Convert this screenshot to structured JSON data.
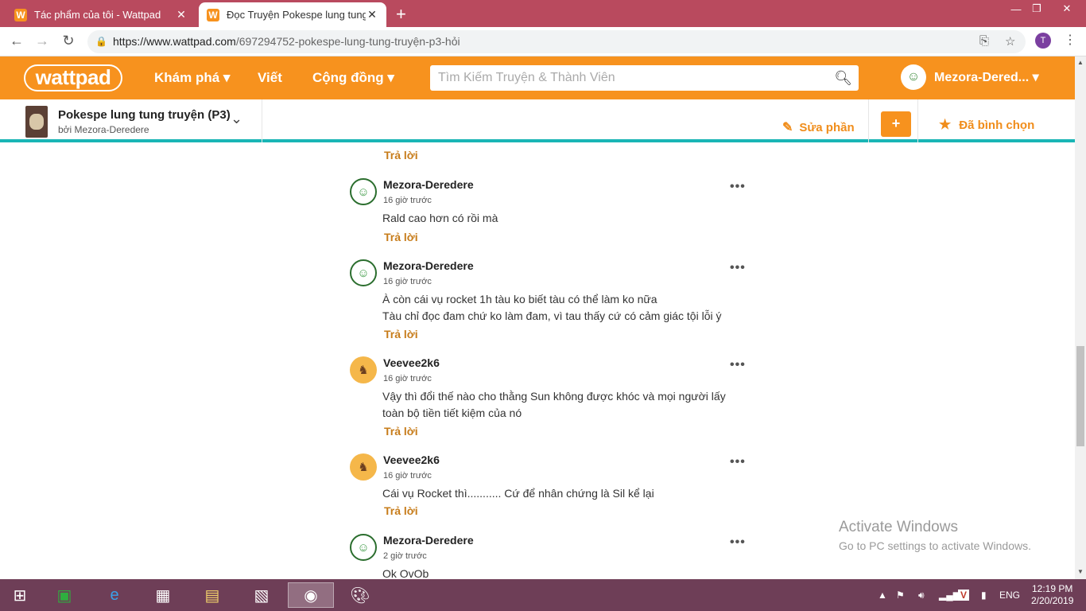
{
  "browser": {
    "tabs": [
      {
        "label": "Tác phẩm của tôi - Wattpad",
        "icon": "wattpad-icon"
      },
      {
        "label": "Đọc Truyện Pokespe lung tung tr",
        "icon": "wattpad-icon"
      }
    ],
    "url_host": "https://www.wattpad.com",
    "url_path": "/697294752-pokespe-lung-tung-truyện-p3-hỏi",
    "profile_initial": "T"
  },
  "wattpad_nav": {
    "logo": "wattpad",
    "links": [
      "Khám phá ▾",
      "Viết",
      "Cộng đồng ▾"
    ],
    "search_placeholder": "Tìm Kiếm Truyện & Thành Viên",
    "username": "Mezora-Dered... ▾"
  },
  "story": {
    "title": "Pokespe lung tung truyện (P3)",
    "byline": "bởi Mezora-Deredere",
    "edit_label": "Sửa phần",
    "add_label": "+",
    "vote_label": "Đã bình chọn"
  },
  "reply_label": "Trả lời",
  "comments": [
    {
      "name": "Mezora-Deredere",
      "time": "16 giờ trước",
      "lines": [
        "Rald cao hơn có rồi mà"
      ],
      "avatar": "mezora"
    },
    {
      "name": "Mezora-Deredere",
      "time": "16 giờ trước",
      "lines": [
        "À còn cái vụ rocket 1h tàu ko biết tàu có thể làm ko nữa",
        "Tàu chỉ đọc đam chứ ko làm đam, vì tau thấy cứ có cảm giác tội lỗi ý"
      ],
      "avatar": "mezora"
    },
    {
      "name": "Veevee2k6",
      "time": "16 giờ trước",
      "lines": [
        "Vậy thì đổi thế nào cho thằng Sun không được khóc và mọi người lấy",
        "toàn bộ tiền tiết kiệm của nó"
      ],
      "avatar": "veevee"
    },
    {
      "name": "Veevee2k6",
      "time": "16 giờ trước",
      "lines": [
        "Cái vụ Rocket thì........... Cứ để nhân chứng là Sil kể lại"
      ],
      "avatar": "veevee"
    },
    {
      "name": "Mezora-Deredere",
      "time": "2 giờ trước",
      "lines": [
        "Ok OvOb"
      ],
      "avatar": "mezora"
    }
  ],
  "watermark": {
    "line1": "Activate Windows",
    "line2": "Go to PC settings to activate Windows."
  },
  "taskbar": {
    "lang": "ENG",
    "time": "12:19 PM",
    "date": "2/20/2019"
  },
  "colors": {
    "brand": "#f7921e",
    "accent_line": "#19b5b5",
    "reply": "#c77c1a",
    "tabbar": "#b94a5e",
    "taskbar": "#6e3e57"
  }
}
